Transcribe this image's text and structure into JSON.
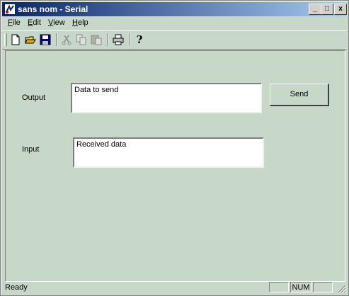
{
  "window": {
    "title": "sans nom - Serial",
    "controls": {
      "minimize": "_",
      "maximize": "□",
      "close": "x"
    }
  },
  "menubar": {
    "items": [
      {
        "key": "F",
        "rest": "ile"
      },
      {
        "key": "E",
        "rest": "dit"
      },
      {
        "key": "V",
        "rest": "iew"
      },
      {
        "key": "H",
        "rest": "elp"
      }
    ]
  },
  "toolbar": {
    "icons": [
      "new-file-icon",
      "open-folder-icon",
      "save-disk-icon",
      "cut-scissors-icon",
      "copy-icon",
      "paste-icon",
      "print-icon",
      "help-question-icon"
    ],
    "help_glyph": "?"
  },
  "form": {
    "output_label": "Output",
    "output_value": "Data to send",
    "input_label": "Input",
    "input_value": "Received data",
    "send_label": "Send"
  },
  "statusbar": {
    "text": "Ready",
    "indicator_num": "NUM"
  },
  "colors": {
    "titlebar_start": "#0a246a",
    "titlebar_end": "#a6caf0",
    "client_bg": "#c8d8c8"
  }
}
